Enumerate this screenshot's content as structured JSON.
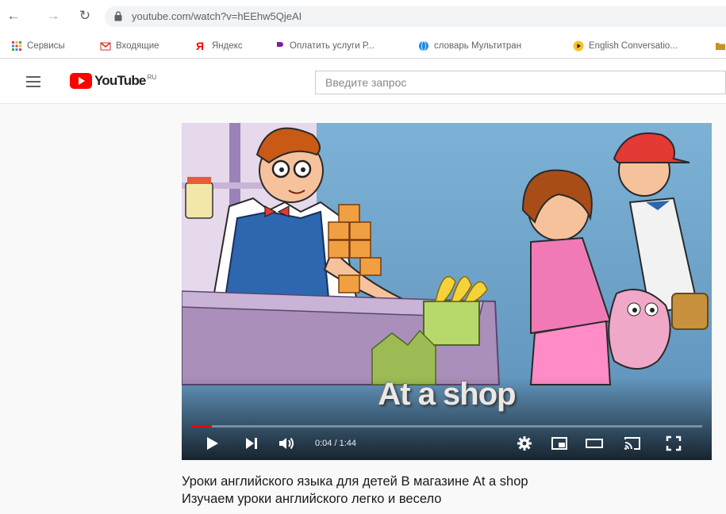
{
  "browser": {
    "url": "youtube.com/watch?v=hEEhw5QjeAI",
    "bookmarks": [
      {
        "label": "Сервисы",
        "icon": "apps-grid-icon"
      },
      {
        "label": "Входящие",
        "icon": "gmail-icon"
      },
      {
        "label": "Яндекс",
        "icon": "yandex-icon"
      },
      {
        "label": "Оплатить услуги Р...",
        "icon": "payment-icon"
      },
      {
        "label": "словарь Мультитран",
        "icon": "multitran-icon"
      },
      {
        "label": "English Conversatio...",
        "icon": "play-circle-icon"
      }
    ]
  },
  "youtube": {
    "logo_text": "YouTube",
    "region": "RU",
    "search_placeholder": "Введите запрос"
  },
  "video": {
    "overlay_title": "At a shop",
    "time_current": "0:04",
    "time_total": "1:44",
    "time_display": "0:04 / 1:44",
    "progress_fraction": 0.04
  },
  "description": {
    "line1": "Уроки английского языка для детей В магазине At a shop",
    "line2": "Изучаем уроки английского легко и весело"
  },
  "colors": {
    "yt_red": "#ff0000",
    "scene_sky": "#6f9ec4",
    "counter_purple": "#a98fb9"
  }
}
